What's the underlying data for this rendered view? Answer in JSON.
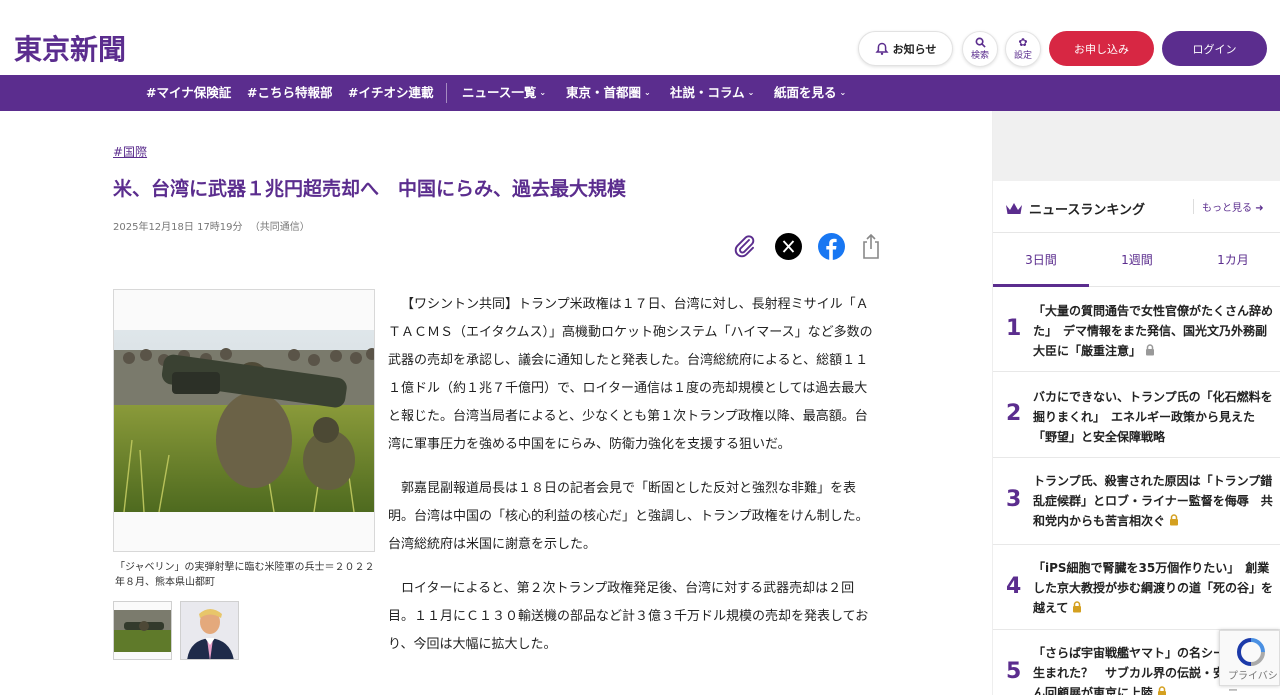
{
  "header": {
    "logo": "東京新聞",
    "notice": "お知らせ",
    "search": "検索",
    "settings": "設定",
    "apply": "お申し込み",
    "login": "ログイン"
  },
  "nav": {
    "items": [
      "#マイナ保険証",
      "#こちら特報部",
      "#イチオシ連載",
      "ニュース一覧",
      "東京・首都圏",
      "社説・コラム",
      "紙面を見る"
    ]
  },
  "article": {
    "tag": "#国際",
    "title": "米、台湾に武器１兆円超売却へ　中国にらみ、過去最大規模",
    "date": "2025年12月18日 17時19分",
    "source": "（共同通信）",
    "caption": "「ジャベリン」の実弾射撃に臨む米陸軍の兵士＝２０２２年８月、熊本県山都町",
    "paragraphs": [
      "【ワシントン共同】トランプ米政権は１７日、台湾に対し、長射程ミサイル「ＡＴＡＣＭＳ（エイタクムス）」高機動ロケット砲システム「ハイマース」など多数の武器の売却を承認し、議会に通知したと発表した。台湾総統府によると、総額１１１億ドル（約１兆７千億円）で、ロイター通信は１度の売却規模としては過去最大と報じた。台湾当局者によると、少なくとも第１次トランプ政権以降、最高額。台湾に軍事圧力を強める中国をにらみ、防衛力強化を支援する狙いだ。",
      "郭嘉昆副報道局長は１８日の記者会見で「断固とした反対と強烈な非難」を表明。台湾は中国の「核心的利益の核心だ」と強調し、トランプ政権をけん制した。台湾総統府は米国に謝意を示した。",
      "ロイターによると、第２次トランプ政権発足後、台湾に対する武器売却は２回目。１１月にＣ１３０輸送機の部品など計３億３千万ドル規模の売却を発表しており、今回は大幅に拡大した。"
    ]
  },
  "sidebar": {
    "heading": "ニュースランキング",
    "more": "もっと見る",
    "tabs": [
      "3日間",
      "1週間",
      "1カ月"
    ],
    "items": [
      {
        "num": "1",
        "title": "「大量の質問通告で女性官僚がたくさん辞めた」　デマ情報をまた発信、国光文乃外務副大臣に「厳重注意」",
        "locked": true
      },
      {
        "num": "2",
        "title": "バカにできない、トランプ氏の「化石燃料を掘りまくれ」　エネルギー政策から見えた「野望」と安全保障戦略",
        "locked": false
      },
      {
        "num": "3",
        "title": "トランプ氏、殺害された原因は「トランプ錯乱症候群」とロブ・ライナー監督を侮辱　共和党内からも苦言相次ぐ",
        "locked": true
      },
      {
        "num": "4",
        "title": "「iPS細胞で腎臓を35万個作りたい」　創業した京大教授が歩む綱渡りの道「死の谷」を越えて",
        "locked": true
      },
      {
        "num": "5",
        "title": "「さらば宇宙戦艦ヤマト」の名シーンはなぜ生まれた？　サブカル界の伝説・安彦良和さん回顧展が東京に上陸",
        "locked": true
      }
    ]
  },
  "recaptcha": {
    "text": "プライバシー"
  },
  "colors": {
    "brand": "#5b2d8e",
    "accent": "#d72743"
  }
}
